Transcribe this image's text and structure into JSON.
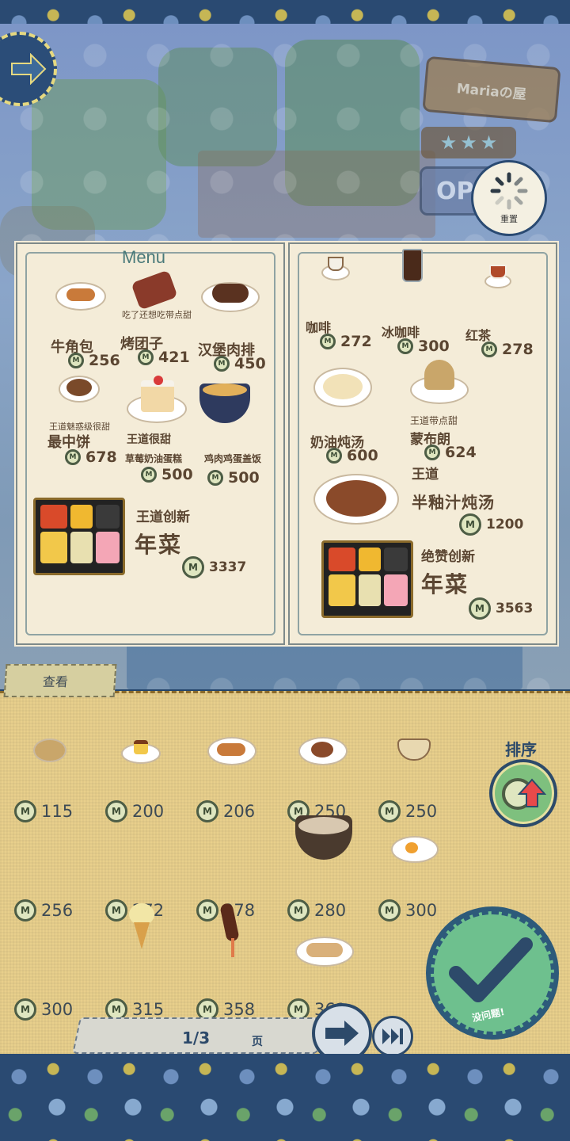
{
  "shop": {
    "name": "Mariaの屋",
    "stars": 3,
    "open_sign": "OP",
    "reset_label": "重置"
  },
  "menu_left": {
    "title": "Menu",
    "items": [
      {
        "name": "牛角包",
        "price": "256",
        "note": ""
      },
      {
        "name": "烤团子",
        "price": "421",
        "note": "吃了还想吃带点甜"
      },
      {
        "name": "汉堡肉排",
        "price": "450",
        "note": ""
      },
      {
        "name": "最中饼",
        "price": "678",
        "note": "王道魅惑级很甜"
      },
      {
        "name": "草莓奶油蛋糕",
        "price": "500",
        "note": "王道很甜"
      },
      {
        "name": "鸡肉鸡蛋盖饭",
        "price": "500",
        "note": ""
      }
    ],
    "feature": {
      "tag": "王道创新",
      "name": "年菜",
      "price": "3337"
    }
  },
  "menu_right": {
    "items": [
      {
        "name": "咖啡",
        "price": "272"
      },
      {
        "name": "冰咖啡",
        "price": "300"
      },
      {
        "name": "红茶",
        "price": "278"
      },
      {
        "name": "奶油炖汤",
        "price": "600"
      },
      {
        "name": "蒙布朗",
        "price": "624",
        "note": "王道带点甜"
      }
    ],
    "stew": {
      "tag": "王道",
      "name": "半釉汁炖汤",
      "price": "1200"
    },
    "feature": {
      "tag": "绝赞创新",
      "name": "年菜",
      "price": "3563"
    }
  },
  "tray": {
    "tab_label": "查看",
    "sort_label": "排序",
    "ok_label": "没问题!",
    "items": [
      {
        "price": "115",
        "icon": "tempura-icon"
      },
      {
        "price": "200",
        "icon": "pudding-icon"
      },
      {
        "price": "206",
        "icon": "croissant-icon"
      },
      {
        "price": "250",
        "icon": "bread-icon"
      },
      {
        "price": "250",
        "icon": "soup-bowl-icon"
      },
      {
        "price": "256",
        "icon": ""
      },
      {
        "price": "272",
        "icon": ""
      },
      {
        "price": "278",
        "icon": ""
      },
      {
        "price": "280",
        "icon": "noodle-bowl-icon"
      },
      {
        "price": "300",
        "icon": "fried-egg-icon"
      },
      {
        "price": "300",
        "icon": ""
      },
      {
        "price": "315",
        "icon": "ice-cream-icon"
      },
      {
        "price": "358",
        "icon": "chocolate-banana-icon"
      },
      {
        "price": "361",
        "icon": "gyoza-icon"
      }
    ]
  },
  "pager": {
    "current": "1/3",
    "unit": "页"
  },
  "coin_letter": "M",
  "colors": {
    "card": "#f4ecd8",
    "tray": "#e8cf8c",
    "ink": "#5b4632",
    "navy": "#2d4a6a",
    "ok": "#6ec08e"
  }
}
